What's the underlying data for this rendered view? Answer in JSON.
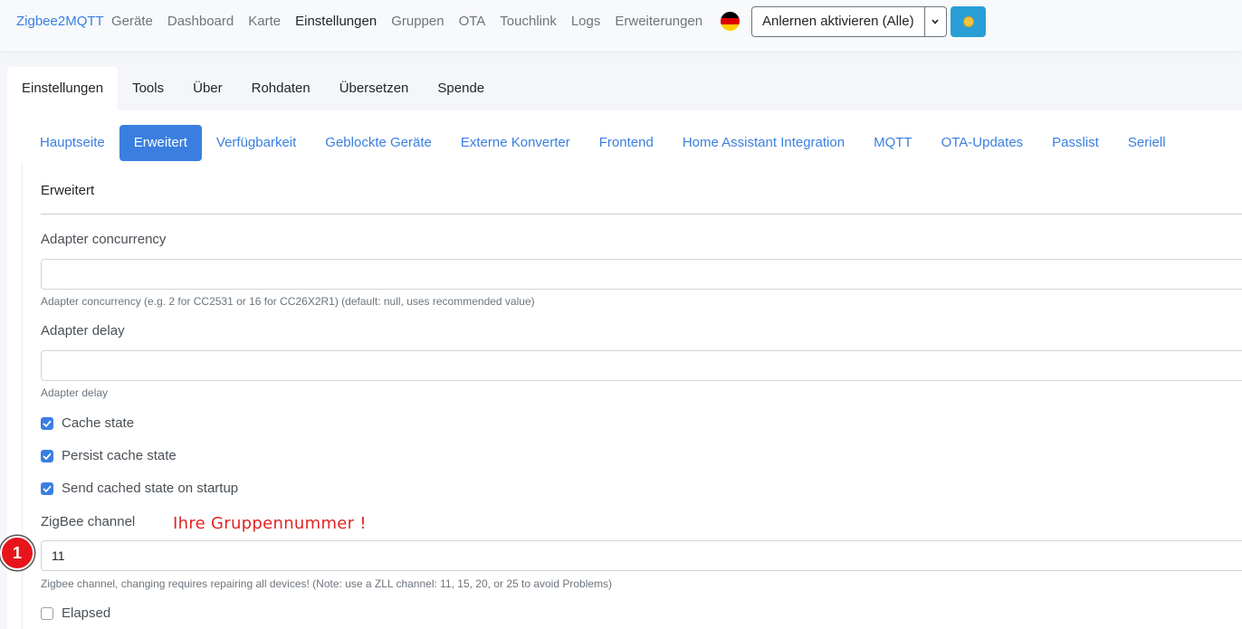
{
  "navbar": {
    "brand": "Zigbee2MQTT",
    "links": [
      "Geräte",
      "Dashboard",
      "Karte",
      "Einstellungen",
      "Gruppen",
      "OTA",
      "Touchlink",
      "Logs",
      "Erweiterungen"
    ],
    "active_link": "Einstellungen",
    "permit_join_label": "Anlernen aktivieren (Alle)",
    "flag_colors": [
      "#000000",
      "#dd0000",
      "#ffce00"
    ],
    "theme_icon": "sun-icon"
  },
  "main_tabs": {
    "items": [
      "Einstellungen",
      "Tools",
      "Über",
      "Rohdaten",
      "Übersetzen",
      "Spende"
    ],
    "active": "Einstellungen"
  },
  "sub_tabs": {
    "items": [
      "Hauptseite",
      "Erweitert",
      "Verfügbarkeit",
      "Geblockte Geräte",
      "Externe Konverter",
      "Frontend",
      "Home Assistant Integration",
      "MQTT",
      "OTA-Updates",
      "Passlist",
      "Seriell"
    ],
    "active": "Erweitert"
  },
  "form": {
    "legend": "Erweitert",
    "adapter_concurrency": {
      "label": "Adapter concurrency",
      "value": "",
      "help": "Adapter concurrency (e.g. 2 for CC2531 or 16 for CC26X2R1) (default: null, uses recommended value)"
    },
    "adapter_delay": {
      "label": "Adapter delay",
      "value": "",
      "help": "Adapter delay"
    },
    "checkboxes": [
      {
        "label": "Cache state",
        "checked": true
      },
      {
        "label": "Persist cache state",
        "checked": true
      },
      {
        "label": "Send cached state on startup",
        "checked": true
      }
    ],
    "zigbee_channel": {
      "label": "ZigBee channel",
      "value": "11",
      "help": "Zigbee channel, changing requires repairing all devices! (Note: use a ZLL channel: 11, 15, 20, or 25 to avoid Problems)"
    },
    "elapsed": {
      "label": "Elapsed",
      "checked": false
    }
  },
  "annotation": {
    "text": "Ihre Gruppennummer !",
    "marker": "1",
    "color": "#e02424"
  },
  "colors": {
    "accent": "#3a7fe0",
    "theme_button": "#2a9fd6"
  }
}
